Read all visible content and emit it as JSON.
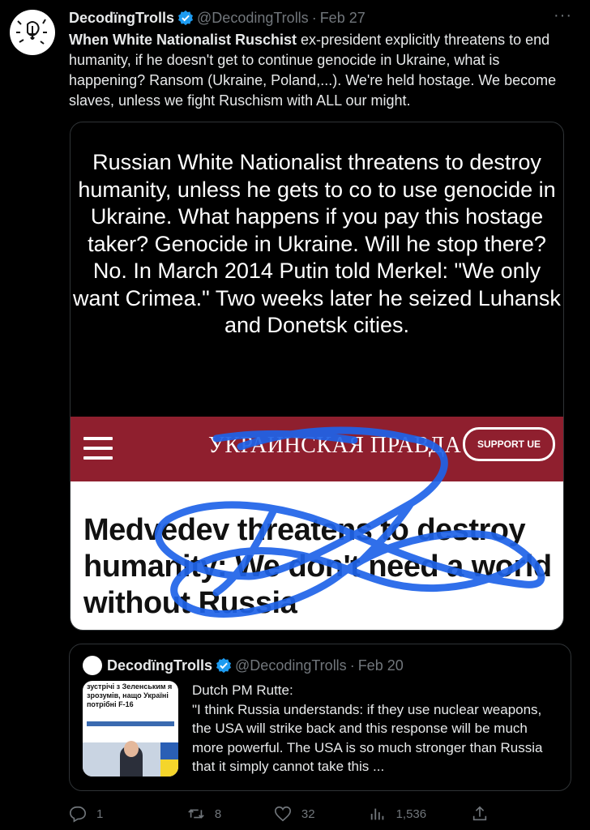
{
  "tweet": {
    "author_name": "DecodïngTrolls",
    "handle": "@DecodingTrolls",
    "separator": "·",
    "date": "Feb 27",
    "more_icon": "more-dots-icon",
    "text_bold": "When White Nationalist Ruschist",
    "text_rest": " ex-president explicitly threatens to end humanity, if he doesn't get to continue genocide in Ukraine, what is happening? Ransom (Ukraine, Poland,...). We're held hostage. We become slaves, unless we fight Ruschism with ALL our might."
  },
  "media": {
    "caption": "Russian White Nationalist threatens to destroy humanity, unless he gets to co to use genocide in Ukraine. What happens if you pay this hostage taker? Genocide in Ukraine. Will he stop there? No. In March 2014 Putin told Merkel: \"We only want Crimea.\" Two weeks later he seized Luhansk and Donetsk cities.",
    "site_logo": "УКРАИНСКАЯ ПРАВДА",
    "support_button": "SUPPORT UE",
    "headline": "Medvedev threatens to destroy humanity: We don't need a world without Russia",
    "bar_color": "#8f1f2e",
    "scribble_color": "#1e63e8"
  },
  "quote": {
    "author_name": "DecodïngTrolls",
    "handle": "@DecodingTrolls",
    "separator": "·",
    "date": "Feb 20",
    "thumb_title": "зустрічі з Зеленським я зрозумів, нащо Україні потрібні F-16",
    "text": "Dutch PM Rutte:\n\"I think Russia understands: if they use nuclear weapons, the USA will strike back and this response will be much more powerful.  The USA is so much stronger than Russia that it simply cannot take this ..."
  },
  "actions": {
    "replies": "1",
    "retweets": "8",
    "likes": "32",
    "views": "1,536"
  },
  "colors": {
    "background": "#000000",
    "text": "#e7e9ea",
    "muted": "#71767b",
    "verified": "#1d9bf0"
  }
}
